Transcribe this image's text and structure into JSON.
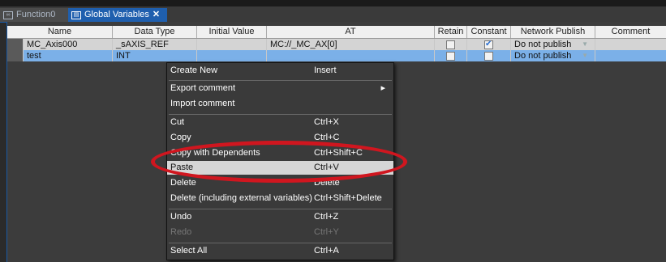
{
  "tabs": [
    {
      "label": "Function0",
      "icon": "function-icon",
      "active": false
    },
    {
      "label": "Global Variables",
      "icon": "table-icon",
      "active": true,
      "close": "✕"
    }
  ],
  "columns": [
    "Name",
    "Data Type",
    "Initial Value",
    "AT",
    "Retain",
    "Constant",
    "Network Publish",
    "Comment"
  ],
  "rows": [
    {
      "name": "MC_Axis000",
      "data_type": "_sAXIS_REF",
      "initial_value": "",
      "at": "MC://_MC_AX[0]",
      "retain": false,
      "constant": true,
      "network_publish": "Do not publish",
      "comment": ""
    },
    {
      "name": "test",
      "data_type": "INT",
      "initial_value": "",
      "at": "",
      "retain": false,
      "constant": false,
      "network_publish": "Do not publish",
      "comment": ""
    }
  ],
  "context_menu": {
    "items": [
      {
        "label": "Create New",
        "shortcut": "Insert"
      },
      {
        "label": "Export comment",
        "shortcut": "▸"
      },
      {
        "label": "Import comment",
        "shortcut": ""
      },
      {
        "label": "Cut",
        "shortcut": "Ctrl+X"
      },
      {
        "label": "Copy",
        "shortcut": "Ctrl+C"
      },
      {
        "label": "Copy with Dependents",
        "shortcut": "Ctrl+Shift+C"
      },
      {
        "label": "Paste",
        "shortcut": "Ctrl+V"
      },
      {
        "label": "Delete",
        "shortcut": "Delete"
      },
      {
        "label": "Delete (including external variables)",
        "shortcut": "Ctrl+Shift+Delete"
      },
      {
        "label": "Undo",
        "shortcut": "Ctrl+Z"
      },
      {
        "label": "Redo",
        "shortcut": "Ctrl+Y"
      },
      {
        "label": "Select All",
        "shortcut": "Ctrl+A"
      }
    ],
    "highlighted": "Paste"
  },
  "colors": {
    "accent": "#1f5fae",
    "highlight_ring": "#d0161f",
    "selected_row": "#7bb0e8"
  }
}
